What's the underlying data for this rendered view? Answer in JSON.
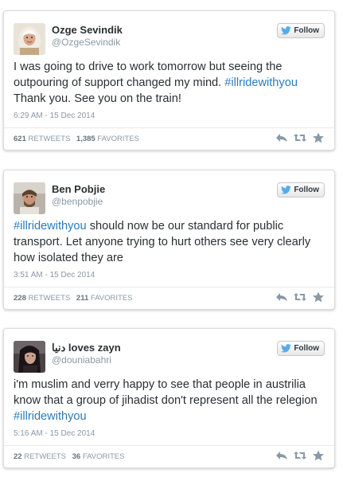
{
  "colors": {
    "link": "#2b7bb9",
    "muted": "#8899a6",
    "text": "#292f33",
    "twitter_blue": "#55acee"
  },
  "follow_label": "Follow",
  "tweets": [
    {
      "name": "Ozge Sevindik",
      "handle": "@OzgeSevindik",
      "text_parts": {
        "a": "I was going to drive to work tomorrow but seeing the outpouring of support changed my mind. ",
        "hashtag": "#illridewithyou",
        "b": " Thank you. See you on the train!"
      },
      "timestamp": "6:29 AM - 15 Dec 2014",
      "retweets": "621",
      "retweets_label": "RETWEETS",
      "favorites": "1,385",
      "favorites_label": "FAVORITES"
    },
    {
      "name": "Ben Pobjie",
      "handle": "@benpobjie",
      "text_parts": {
        "a": "",
        "hashtag": "#illridewithyou",
        "b": " should now be our standard for public transport. Let anyone trying to hurt others see very clearly how isolated they are"
      },
      "timestamp": "3:51 AM - 15 Dec 2014",
      "retweets": "228",
      "retweets_label": "RETWEETS",
      "favorites": "211",
      "favorites_label": "FAVORITES"
    },
    {
      "name": "دنيا loves zayn",
      "handle": "@douniabahri",
      "text_parts": {
        "a": "i'm muslim and verry happy to see that people in austrilia know that a group of jihadist don't represent all the relegion ",
        "hashtag": "#illridewithyou",
        "b": ""
      },
      "timestamp": "5:16 AM - 15 Dec 2014",
      "retweets": "22",
      "retweets_label": "RETWEETS",
      "favorites": "36",
      "favorites_label": "FAVORITES"
    }
  ]
}
